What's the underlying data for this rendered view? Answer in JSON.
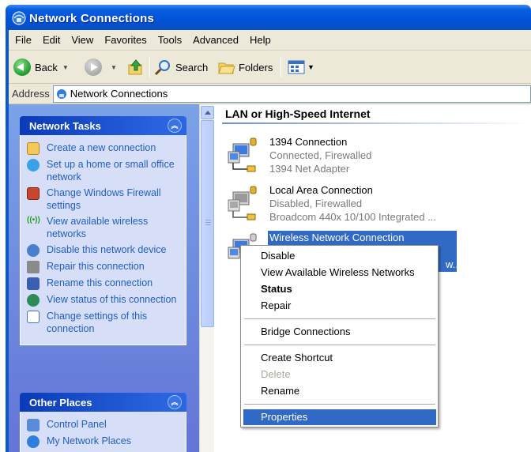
{
  "window": {
    "title": "Network Connections"
  },
  "menu": [
    "File",
    "Edit",
    "View",
    "Favorites",
    "Tools",
    "Advanced",
    "Help"
  ],
  "toolbar": {
    "back": "Back",
    "search": "Search",
    "folders": "Folders"
  },
  "address": {
    "label": "Address",
    "value": "Network Connections"
  },
  "network_tasks": {
    "title": "Network Tasks",
    "items": [
      {
        "label": "Create a new connection",
        "icon": "new-connection-icon"
      },
      {
        "label": "Set up a home or small office network",
        "icon": "home-network-icon"
      },
      {
        "label": "Change Windows Firewall settings",
        "icon": "firewall-icon"
      },
      {
        "label": "View available wireless networks",
        "icon": "wireless-icon"
      },
      {
        "label": "Disable this network device",
        "icon": "disable-icon"
      },
      {
        "label": "Repair this connection",
        "icon": "repair-icon"
      },
      {
        "label": "Rename this connection",
        "icon": "rename-icon"
      },
      {
        "label": "View status of this connection",
        "icon": "status-icon"
      },
      {
        "label": "Change settings of this connection",
        "icon": "settings-icon"
      }
    ]
  },
  "other_places": {
    "title": "Other Places",
    "items": [
      {
        "label": "Control Panel",
        "icon": "control-panel-icon"
      },
      {
        "label": "My Network Places",
        "icon": "network-places-icon"
      }
    ]
  },
  "section": {
    "title": "LAN or High-Speed Internet"
  },
  "connections": [
    {
      "name": "1394 Connection",
      "status": "Connected, Firewalled",
      "device": "1394 Net Adapter"
    },
    {
      "name": "Local Area Connection",
      "status": "Disabled, Firewalled",
      "device": "Broadcom 440x 10/100 Integrated ..."
    },
    {
      "name": "Wireless Network Connection",
      "status": "",
      "device": "w..."
    }
  ],
  "context_menu": {
    "items": [
      "Disable",
      "View Available Wireless Networks",
      "Status",
      "Repair",
      "Bridge Connections",
      "Create Shortcut",
      "Delete",
      "Rename",
      "Properties"
    ]
  },
  "colors": {
    "accent": "#316ac5",
    "titlebar": "#0052d6",
    "link": "#215dc6"
  }
}
